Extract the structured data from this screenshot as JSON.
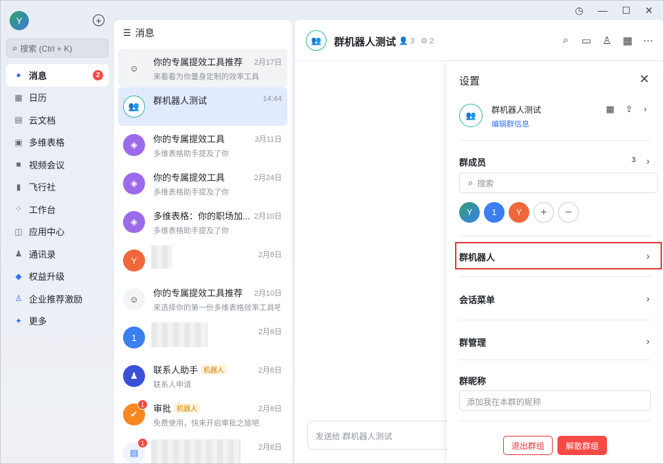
{
  "user": {
    "avatar_letter": "Y"
  },
  "sidebar": {
    "search_placeholder": "搜索 (Ctrl + K)",
    "items": [
      {
        "label": "消息",
        "icon": "message-icon",
        "badge": "2",
        "active": true
      },
      {
        "label": "日历",
        "icon": "calendar-icon"
      },
      {
        "label": "云文档",
        "icon": "doc-icon"
      },
      {
        "label": "多维表格",
        "icon": "table-icon"
      },
      {
        "label": "视频会议",
        "icon": "video-icon"
      },
      {
        "label": "飞行社",
        "icon": "book-icon"
      },
      {
        "label": "工作台",
        "icon": "workbench-icon"
      },
      {
        "label": "应用中心",
        "icon": "appcenter-icon"
      },
      {
        "label": "通讯录",
        "icon": "contacts-icon"
      },
      {
        "label": "权益升级",
        "icon": "diamond-icon"
      },
      {
        "label": "企业推荐激励",
        "icon": "recommend-icon"
      },
      {
        "label": "更多",
        "icon": "more-apps-icon"
      }
    ]
  },
  "chatlist": {
    "title": "消息",
    "chats": [
      {
        "name": "你的专属提效工具推荐",
        "time": "2月17日",
        "preview": "来看看为你量身定制的效率工具",
        "avatar": "person"
      },
      {
        "name": "群机器人测试",
        "time": "14:44",
        "preview": "",
        "avatar": "group"
      },
      {
        "name": "你的专属提效工具",
        "time": "3月11日",
        "preview": "多维表格助手提及了你",
        "avatar": "bitable"
      },
      {
        "name": "你的专属提效工具",
        "time": "2月24日",
        "preview": "多维表格助手提及了你",
        "avatar": "bitable"
      },
      {
        "name": "多维表格：你的职场加...",
        "time": "2月10日",
        "preview": "多维表格助手提及了你",
        "avatar": "bitable"
      },
      {
        "name": "",
        "time": "2月8日",
        "preview": "",
        "avatar": "Y"
      },
      {
        "name": "你的专属提效工具推荐",
        "time": "2月10日",
        "preview": "来选择你的第一份多维表格效率工具吧",
        "avatar": "person"
      },
      {
        "name": "",
        "time": "2月8日",
        "preview": "",
        "avatar": "1"
      },
      {
        "name": "联系人助手",
        "tag": "机器人",
        "time": "2月8日",
        "preview": "联系人申请",
        "avatar": "contact-bot"
      },
      {
        "name": "审批",
        "tag": "机器人",
        "time": "2月8日",
        "preview": "免费使用，快来开启审批之旅吧",
        "avatar": "approval",
        "badge": "1"
      },
      {
        "name": "",
        "time": "2月8日",
        "preview": "",
        "avatar": "doc",
        "badge": "1"
      }
    ]
  },
  "main": {
    "title": "群机器人测试",
    "member_count": "3",
    "bot_count": "2",
    "composer_placeholder": "发送给 群机器人测试"
  },
  "settings": {
    "title": "设置",
    "group_name": "群机器人测试",
    "edit_link": "编辑群信息",
    "members_label": "群成员",
    "members_count": "3",
    "members_search_placeholder": "搜索",
    "members": [
      {
        "letter": "Y",
        "color": "#2f9e6e"
      },
      {
        "letter": "1",
        "color": "#3b7ff0"
      },
      {
        "letter": "Y",
        "color": "#f0673c"
      }
    ],
    "bots_label": "群机器人",
    "menu_label": "会话菜单",
    "manage_label": "群管理",
    "nickname_label": "群昵称",
    "nickname_placeholder": "添加我在本群的昵称",
    "quit_label": "退出群组",
    "disband_label": "解散群组"
  },
  "colors": {
    "accent": "#3370ff",
    "danger": "#f54a45",
    "selected_row": "#e1eaff",
    "group_teal": "#2db59f"
  }
}
